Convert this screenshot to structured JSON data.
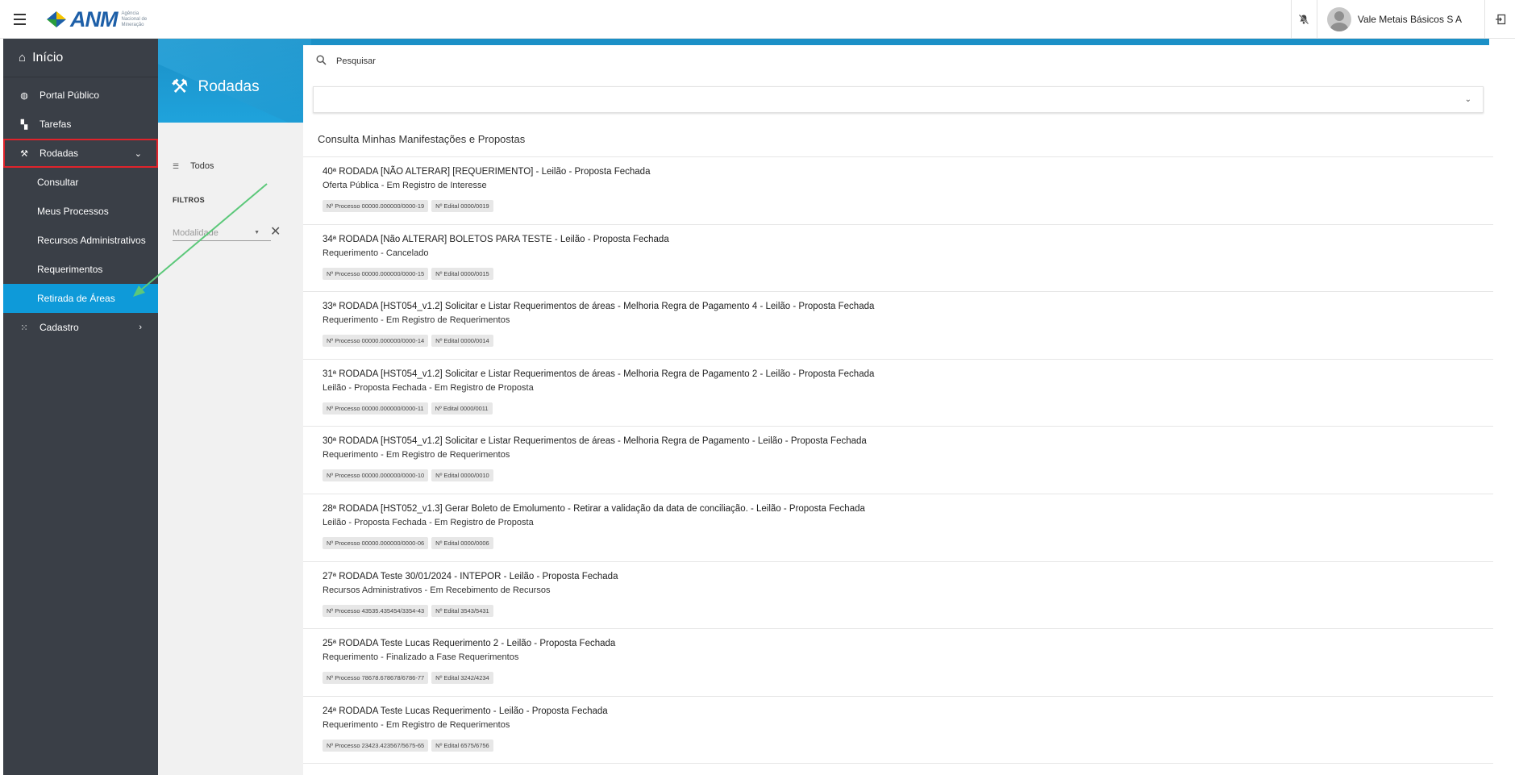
{
  "header": {
    "logo_text": "ANM",
    "logo_subtitle": "Agência Nacional de Mineração",
    "user_name": "Vale Metais Básicos S A",
    "icons": {
      "menu": "menu-icon",
      "bell": "bell-off-icon",
      "exit": "logout-icon"
    }
  },
  "sidebar": {
    "home": "Início",
    "items": [
      {
        "label": "Portal Público",
        "icon": "globe-icon"
      },
      {
        "label": "Tarefas",
        "icon": "dashboard-icon"
      },
      {
        "label": "Rodadas",
        "icon": "gavel-icon"
      },
      {
        "label": "Cadastro",
        "icon": "grid-icon"
      }
    ],
    "subitems": [
      "Consultar",
      "Meus Processos",
      "Recursos Administrativos",
      "Requerimentos",
      "Retirada de Áreas"
    ]
  },
  "page": {
    "title": "Rodadas",
    "search_placeholder": "Pesquisar",
    "list_header": "Consulta Minhas Manifestações e Propostas"
  },
  "filters": {
    "all_label": "Todos",
    "section_label": "FILTROS",
    "modalidade_placeholder": "Modalidade"
  },
  "rows": [
    {
      "title": "40ª RODADA [NÃO ALTERAR] [REQUERIMENTO] - Leilão - Proposta Fechada",
      "subtitle": "Oferta Pública - Em Registro de Interesse",
      "processo": "Nº Processo 00000.000000/0000-19",
      "edital": "Nº Edital 0000/0019"
    },
    {
      "title": "34ª RODADA [Não ALTERAR] BOLETOS PARA TESTE - Leilão - Proposta Fechada",
      "subtitle": "Requerimento - Cancelado",
      "processo": "Nº Processo 00000.000000/0000-15",
      "edital": "Nº Edital 0000/0015"
    },
    {
      "title": "33ª RODADA [HST054_v1.2] Solicitar e Listar Requerimentos de áreas - Melhoria Regra de Pagamento 4 - Leilão - Proposta Fechada",
      "subtitle": "Requerimento - Em Registro de Requerimentos",
      "processo": "Nº Processo 00000.000000/0000-14",
      "edital": "Nº Edital 0000/0014"
    },
    {
      "title": "31ª RODADA [HST054_v1.2] Solicitar e Listar Requerimentos de áreas - Melhoria Regra de Pagamento 2 - Leilão - Proposta Fechada",
      "subtitle": "Leilão - Proposta Fechada - Em Registro de Proposta",
      "processo": "Nº Processo 00000.000000/0000-11",
      "edital": "Nº Edital 0000/0011"
    },
    {
      "title": "30ª RODADA [HST054_v1.2] Solicitar e Listar Requerimentos de áreas - Melhoria Regra de Pagamento - Leilão - Proposta Fechada",
      "subtitle": "Requerimento - Em Registro de Requerimentos",
      "processo": "Nº Processo 00000.000000/0000-10",
      "edital": "Nº Edital 0000/0010"
    },
    {
      "title": "28ª RODADA [HST052_v1.3] Gerar Boleto de Emolumento - Retirar a validação da data de conciliação. - Leilão - Proposta Fechada",
      "subtitle": "Leilão - Proposta Fechada - Em Registro de Proposta",
      "processo": "Nº Processo 00000.000000/0000-06",
      "edital": "Nº Edital 0000/0006"
    },
    {
      "title": "27ª RODADA Teste 30/01/2024 - INTEPOR - Leilão - Proposta Fechada",
      "subtitle": "Recursos Administrativos - Em Recebimento de Recursos",
      "processo": "Nº Processo 43535.435454/3354-43",
      "edital": "Nº Edital 3543/5431"
    },
    {
      "title": "25ª RODADA Teste Lucas Requerimento 2 - Leilão - Proposta Fechada",
      "subtitle": "Requerimento - Finalizado a Fase Requerimentos",
      "processo": "Nº Processo 78678.678678/6786-77",
      "edital": "Nº Edital 3242/4234"
    },
    {
      "title": "24ª RODADA Teste Lucas Requerimento - Leilão - Proposta Fechada",
      "subtitle": "Requerimento - Em Registro de Requerimentos",
      "processo": "Nº Processo 23423.423567/5675-65",
      "edital": "Nº Edital 6575/6756"
    }
  ],
  "colors": {
    "sidebar": "#3a3f47",
    "accent": "#0e9ad9",
    "highlight": "#e0232b",
    "annotation_arrow": "#5cc87a"
  }
}
